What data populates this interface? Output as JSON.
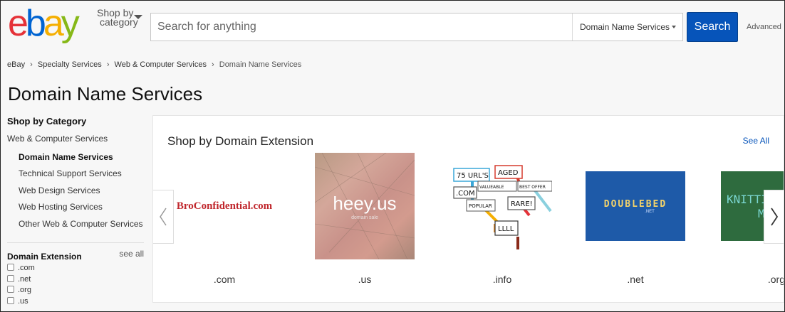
{
  "header": {
    "logo_text": "ebay",
    "shop_by_line1": "Shop by",
    "shop_by_line2": "category",
    "search_placeholder": "Search for anything",
    "category_selected": "Domain Name Services",
    "search_button": "Search",
    "advanced_link": "Advanced"
  },
  "breadcrumb": {
    "items": [
      "eBay",
      "Specialty Services",
      "Web & Computer Services",
      "Domain Name Services"
    ],
    "separator": "›"
  },
  "page_title": "Domain Name Services",
  "sidebar": {
    "heading": "Shop by Category",
    "parent": "Web & Computer Services",
    "items": [
      {
        "label": "Domain Name Services",
        "active": true
      },
      {
        "label": "Technical Support Services",
        "active": false
      },
      {
        "label": "Web Design Services",
        "active": false
      },
      {
        "label": "Web Hosting Services",
        "active": false
      },
      {
        "label": "Other Web & Computer Services",
        "active": false
      }
    ],
    "filter": {
      "title": "Domain Extension",
      "see_all": "see all",
      "options": [
        ".com",
        ".net",
        ".org",
        ".us"
      ]
    }
  },
  "card": {
    "title": "Shop by Domain Extension",
    "see_all": "See All",
    "tiles": [
      {
        "label": ".com",
        "image_text": "BroConfidential.com"
      },
      {
        "label": ".us",
        "image_text": "heey.us",
        "image_subtext": "domain sale"
      },
      {
        "label": ".info",
        "image_words": [
          "75 URL'S",
          "AGED",
          ".COM",
          "VALUEABLE",
          "BEST OFFER",
          "POPULAR",
          "RARE!",
          "LLLL"
        ]
      },
      {
        "label": ".net",
        "image_text": "DOUBLEBED",
        "image_subtext": ".NET"
      },
      {
        "label": ".org",
        "image_text": "KNITTI",
        "image_text2": "M A"
      }
    ]
  },
  "colors": {
    "search_button": "#0654ba",
    "logo_e": "#e53238",
    "logo_b": "#0064d2",
    "logo_a": "#f5af02",
    "logo_y": "#86b817"
  }
}
